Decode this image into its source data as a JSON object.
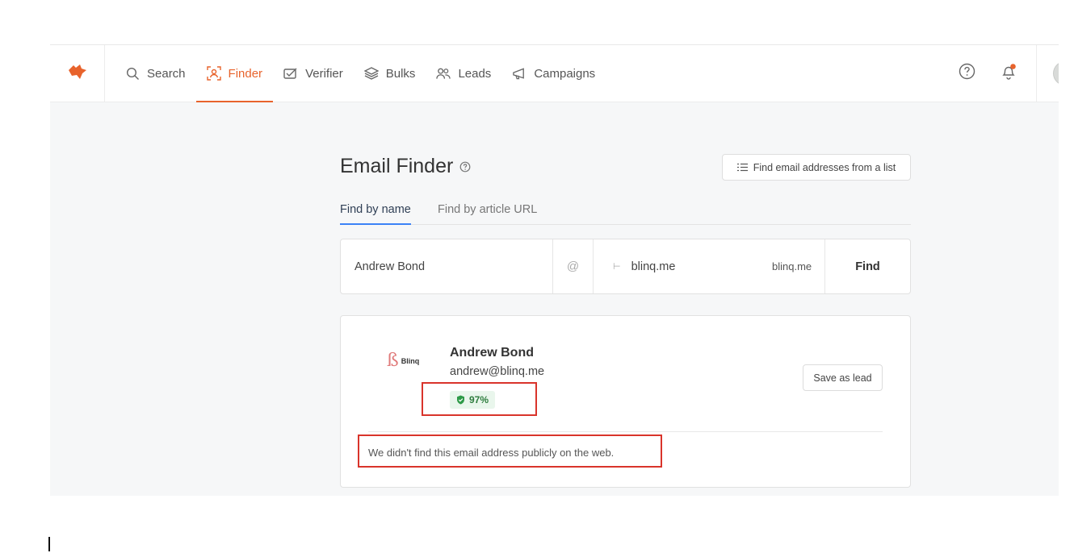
{
  "nav": {
    "logo": "fox-logo-icon",
    "items": [
      {
        "label": "Search",
        "icon": "search-icon"
      },
      {
        "label": "Finder",
        "icon": "finder-icon",
        "active": true
      },
      {
        "label": "Verifier",
        "icon": "verifier-icon"
      },
      {
        "label": "Bulks",
        "icon": "bulks-icon"
      },
      {
        "label": "Leads",
        "icon": "leads-icon"
      },
      {
        "label": "Campaigns",
        "icon": "campaigns-icon"
      }
    ],
    "right_icons": [
      "help-icon",
      "notification-bell-icon",
      "avatar"
    ]
  },
  "page": {
    "title": "Email Finder",
    "list_button": "Find email addresses from a list",
    "tabs": [
      {
        "label": "Find by name",
        "active": true
      },
      {
        "label": "Find by article URL"
      }
    ]
  },
  "search": {
    "name_value": "Andrew Bond",
    "at_symbol": "@",
    "domain_value": "blinq.me",
    "domain_tag": "blinq.me",
    "find_label": "Find"
  },
  "result": {
    "company_logo_text": "Blinq",
    "name": "Andrew Bond",
    "email": "andrew@blinq.me",
    "score": "97%",
    "save_label": "Save as lead",
    "note": "We didn't find this email address publicly on the web."
  },
  "colors": {
    "accent": "#e8632c",
    "tab_underline": "#3b82f6",
    "highlight_box": "#d9342b",
    "score_green": "#2e7d3e"
  }
}
